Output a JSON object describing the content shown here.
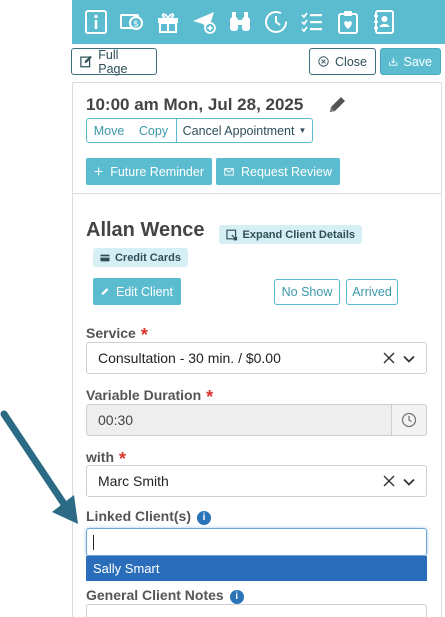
{
  "toolbar": {
    "icons": [
      "info-icon",
      "billing-icon",
      "gift-icon",
      "send-icon",
      "binoculars-icon",
      "history-icon",
      "checklist-icon",
      "clipboard-icon",
      "address-book-icon"
    ],
    "color": "#5bbcd0"
  },
  "top_actions": {
    "full_page_label": "Full Page",
    "close_label": "Close",
    "save_label": "Save"
  },
  "appointment": {
    "datetime": "10:00 am Mon, Jul 28, 2025",
    "move_label": "Move",
    "copy_label": "Copy",
    "cancel_label": "Cancel Appointment",
    "future_reminder_label": "Future Reminder",
    "request_review_label": "Request Review"
  },
  "client": {
    "name": "Allan Wence",
    "expand_label": "Expand Client Details",
    "credit_cards_label": "Credit Cards",
    "edit_label": "Edit Client",
    "no_show_label": "No Show",
    "arrived_label": "Arrived"
  },
  "form": {
    "service_label": "Service",
    "service_value": "Consultation - 30 min. / $0.00",
    "variable_duration_label": "Variable Duration",
    "duration_value": "00:30",
    "with_label": "with",
    "with_value": "Marc Smith",
    "linked_clients_label": "Linked Client(s)",
    "linked_clients_value": "",
    "linked_suggestion": "Sally Smart",
    "general_notes_label": "General Client Notes",
    "required_marker": "*",
    "info_glyph": "i"
  },
  "colors": {
    "accent": "#5bbcd0",
    "dark_text": "#2d4f5a",
    "required": "#d9342b",
    "selection": "#2a6ebb",
    "arrow": "#2c6a85"
  }
}
